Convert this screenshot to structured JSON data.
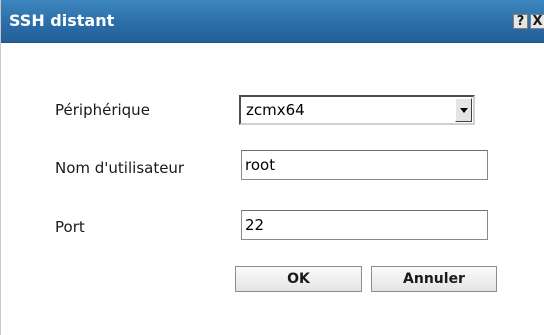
{
  "dialog": {
    "title": "SSH distant",
    "help_label": "?",
    "close_label": "X"
  },
  "form": {
    "device": {
      "label": "Périphérique",
      "selected": "zcmx64"
    },
    "username": {
      "label": "Nom d'utilisateur",
      "value": "root"
    },
    "port": {
      "label": "Port",
      "value": "22"
    }
  },
  "buttons": {
    "ok_label": "OK",
    "cancel_label": "Annuler"
  },
  "colors": {
    "titlebar": "#2b6ea9",
    "title_text": "#ffffff"
  },
  "icons": {
    "select_arrow": "chevron-down-icon"
  }
}
